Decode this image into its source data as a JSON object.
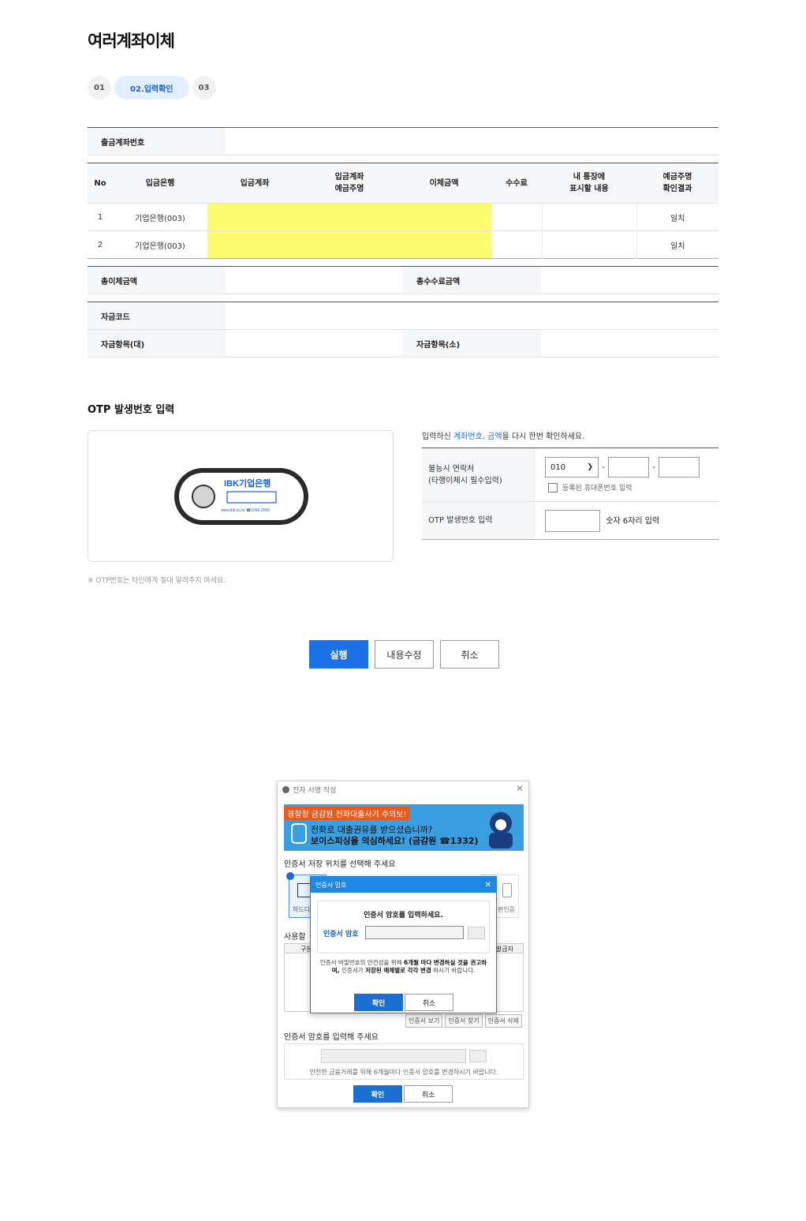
{
  "page_title": "여러계좌이체",
  "steps": [
    {
      "label": "01"
    },
    {
      "label": "02.입력확인"
    },
    {
      "label": "03"
    }
  ],
  "account_table": {
    "out_account_label": "출금계좌번호",
    "out_account_value": ""
  },
  "transfer_grid": {
    "headers": [
      "No",
      "입금은행",
      "입금계좌",
      "입금계좌\n예금주명",
      "이체금액",
      "수수료",
      "내 통장에\n표시할 내용",
      "예금주명\n확인결과"
    ],
    "rows": [
      {
        "no": "1",
        "bank": "기업은행(003)",
        "account": "",
        "holder": "",
        "amount": "",
        "fee": "",
        "memo": "",
        "result": "일치"
      },
      {
        "no": "2",
        "bank": "기업은행(003)",
        "account": "",
        "holder": "",
        "amount": "",
        "fee": "",
        "memo": "",
        "result": "일치"
      }
    ],
    "highlight_color": "#fefb6e"
  },
  "totals": {
    "total_amount_label": "총이체금액",
    "total_fee_label": "총수수료금액"
  },
  "fund": {
    "code_label": "자금코드",
    "major_label": "자금항목(대)",
    "minor_label": "자금항목(소)"
  },
  "otp": {
    "title": "OTP 발생번호 입력",
    "device_brand": "IBK기업은행",
    "device_small": "www.ibk.co.kr ☎1566-2566",
    "note": "※ OTP번호는 타인에게 절대 알려주지 마세요.",
    "confirm_prefix": "입력하신 ",
    "confirm_link1": "계좌번호,",
    "confirm_link2": "금액",
    "confirm_suffix": "을 다시 한번 확인하세요.",
    "contact_label_1": "불능시 연락처",
    "contact_label_2": "(타행이체시 필수입력)",
    "phone_prefix": "010",
    "registered_phone_label": "등록된 휴대폰번호 입력",
    "otp_input_label": "OTP 발생번호 입력",
    "otp_input_hint": "숫자 6자리 입력"
  },
  "actions": {
    "execute": "실행",
    "edit": "내용수정",
    "cancel": "취소"
  },
  "cert_dialog": {
    "title": "전자 서명 작성",
    "banner_tag": "경찰청 금감원 전화대출사기 주의보!",
    "banner_line1": "전화로 대출권유를 받으셨습니까?",
    "banner_line2": "보이스피싱을 의심하세요! (금감원 ☎1332)",
    "location_heading": "인증서 저장 위치를 선택해 주세요",
    "location_hdd": "하드디",
    "location_other": "편인증",
    "user_heading": "사용할",
    "list_col1": "구분",
    "list_col2": "발급자",
    "btn_view": "인증서 보기",
    "btn_find": "인증서 찾기",
    "btn_delete": "인증서 삭제",
    "password_heading": "인증서 암호를 입력해 주세요",
    "password_hint": "안전한 금융거래를 위해 6개월마다 인증서 암호를 변경하시기 바랍니다.",
    "ok": "확인",
    "cancel": "취소"
  },
  "pw_popup": {
    "title": "인증서 암호",
    "message": "인증서 암호를 입력하세요.",
    "field_label": "인증서 암호",
    "note_1": "인증서 비밀번호의 안전성을 위해 ",
    "note_bold1": "6개월 마다",
    "note_2": "변경하실 것을 권고하며, ",
    "note_3": "인증서가 ",
    "note_bold2": "저장된 매체별로 각각 변경",
    "note_4": " 하시기 바랍니다.",
    "ok": "확인",
    "cancel": "취소"
  }
}
